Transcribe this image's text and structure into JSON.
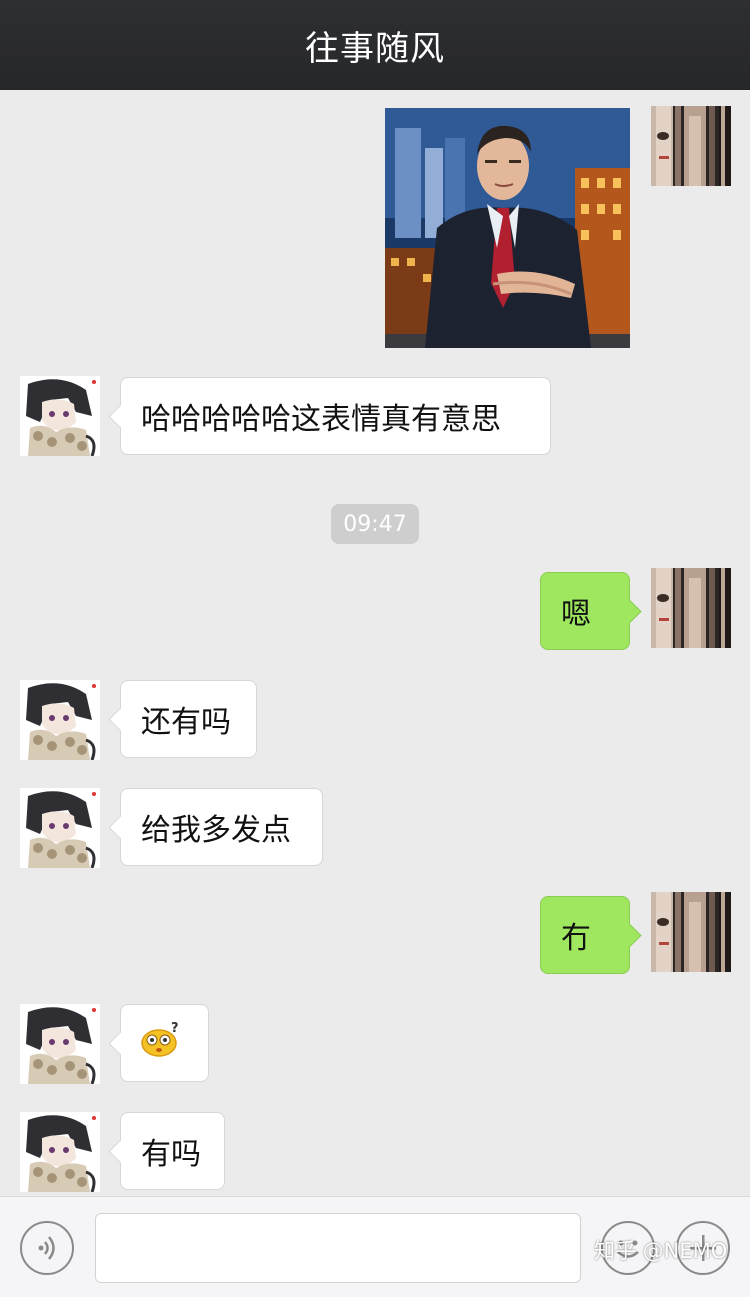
{
  "header": {
    "title": "往事随风"
  },
  "messages": [
    {
      "sender": "self",
      "type": "image"
    },
    {
      "sender": "other",
      "type": "text",
      "text": "哈哈哈哈哈这表情真有意思"
    },
    {
      "type": "timestamp",
      "text": "09:47"
    },
    {
      "sender": "self",
      "type": "text",
      "text": "嗯"
    },
    {
      "sender": "other",
      "type": "text",
      "text": "还有吗"
    },
    {
      "sender": "other",
      "type": "text",
      "text": "给我多发点"
    },
    {
      "sender": "self",
      "type": "text",
      "text": "冇"
    },
    {
      "sender": "other",
      "type": "emoji",
      "icon": "confused-emoji-icon"
    },
    {
      "sender": "other",
      "type": "text",
      "text": "有吗"
    }
  ],
  "input_bar": {
    "voice_icon": "voice-icon",
    "emoji_icon": "smiley-icon",
    "more_icon": "plus-icon",
    "placeholder": ""
  },
  "watermark": "知乎 @NEMO",
  "colors": {
    "title_bar": "#2e2f33",
    "background": "#ebebeb",
    "outgoing_bubble": "#9ee75f",
    "incoming_bubble": "#ffffff",
    "timestamp_pill": "#cecece"
  }
}
